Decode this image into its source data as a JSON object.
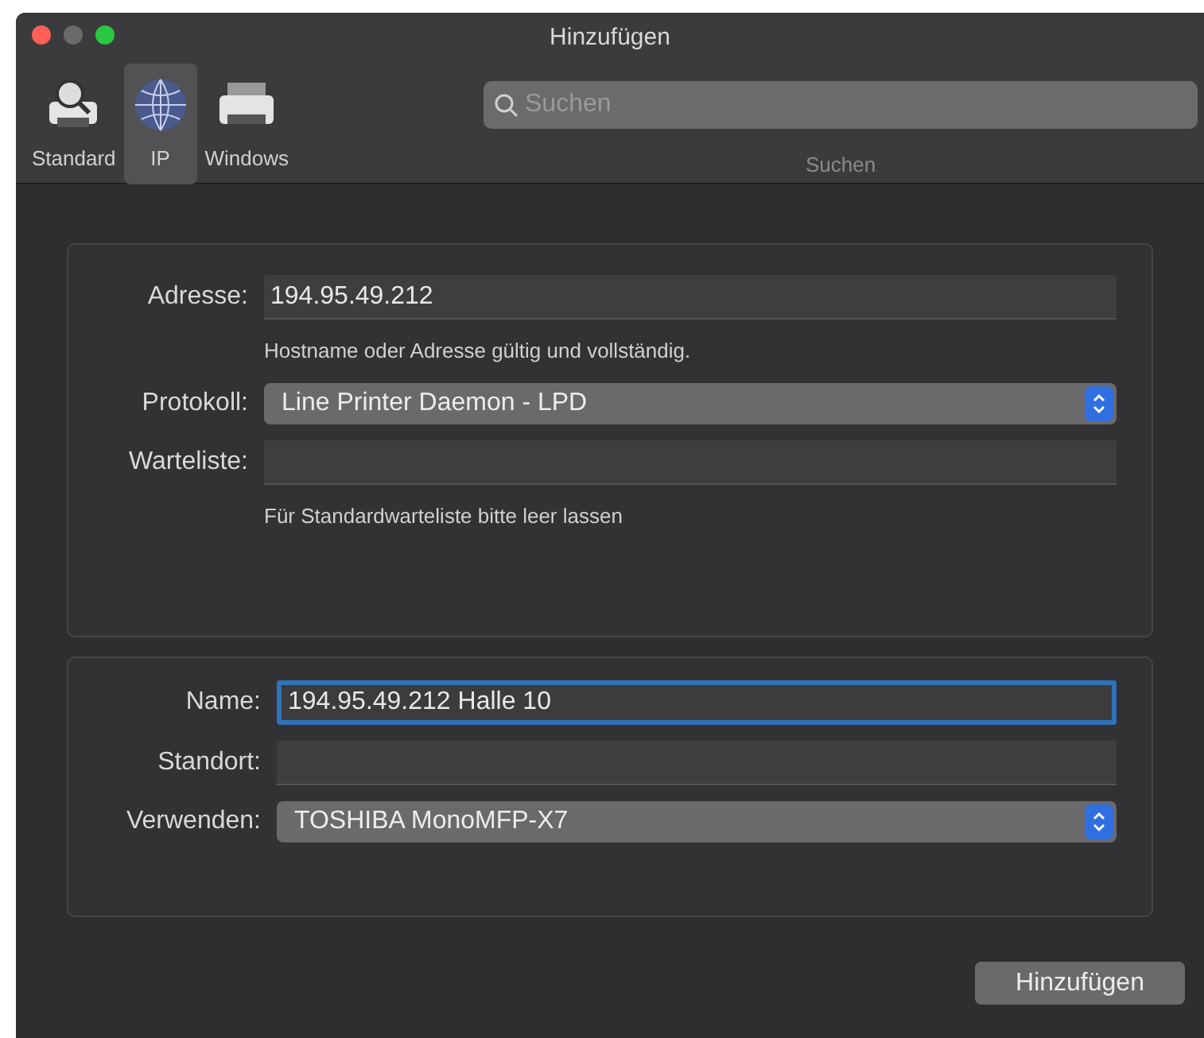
{
  "window": {
    "title": "Hinzufügen"
  },
  "tabs": [
    {
      "label": "Standard",
      "kind": "default-printer",
      "selected": false
    },
    {
      "label": "IP",
      "kind": "globe",
      "selected": true
    },
    {
      "label": "Windows",
      "kind": "printer",
      "selected": false
    }
  ],
  "search": {
    "placeholder": "Suchen",
    "label": "Suchen"
  },
  "sections": [
    {
      "rows": [
        {
          "kind": "text",
          "label": "Adresse:",
          "value": "194.95.49.212",
          "focused": false
        },
        {
          "kind": "hint",
          "text": "Hostname oder Adresse gültig und vollständig."
        },
        {
          "kind": "popup",
          "label": "Protokoll:",
          "value": "Line Printer Daemon - LPD"
        },
        {
          "kind": "text",
          "label": "Warteliste:",
          "focused": false
        },
        {
          "kind": "hint",
          "text": "Für Standardwarteliste bitte leer lassen"
        }
      ]
    },
    {
      "rows": [
        {
          "kind": "text",
          "label": "Name:",
          "value": "194.95.49.212 Halle 10",
          "focused": true
        },
        {
          "kind": "text",
          "label": "Standort:",
          "focused": false
        },
        {
          "kind": "popup",
          "label": "Verwenden:",
          "value": "TOSHIBA MonoMFP-X7"
        }
      ]
    }
  ],
  "button": "Hinzufügen"
}
